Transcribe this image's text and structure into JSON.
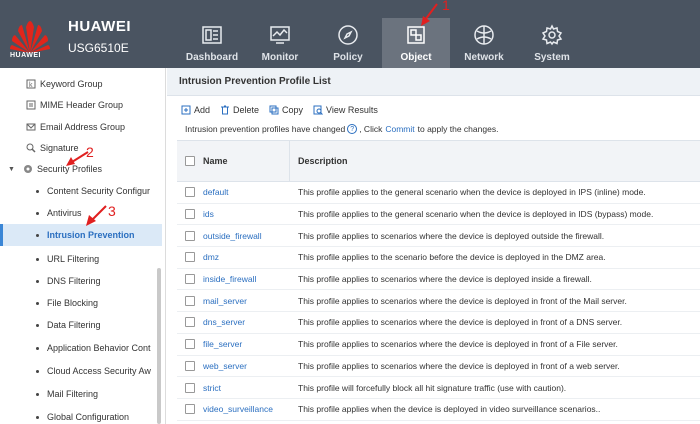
{
  "header": {
    "logo_text": "HUAWEI",
    "brand": "HUAWEI",
    "model": "USG6510E",
    "nav": [
      {
        "label": "Dashboard",
        "icon": "dashboard-icon"
      },
      {
        "label": "Monitor",
        "icon": "monitor-icon"
      },
      {
        "label": "Policy",
        "icon": "compass-icon"
      },
      {
        "label": "Object",
        "icon": "object-icon",
        "active": true
      },
      {
        "label": "Network",
        "icon": "globe-icon"
      },
      {
        "label": "System",
        "icon": "gear-icon"
      }
    ]
  },
  "sidebar": {
    "items": [
      {
        "label": "Keyword Group",
        "icon": "keyword-group-icon"
      },
      {
        "label": "MIME Header Group",
        "icon": "mime-header-icon"
      },
      {
        "label": "Email Address Group",
        "icon": "email-group-icon"
      },
      {
        "label": "Signature",
        "icon": "signature-icon"
      },
      {
        "label": "Security Profiles",
        "icon": "security-profiles-icon"
      },
      {
        "label": "Content Security Configur"
      },
      {
        "label": "Antivirus"
      },
      {
        "label": "Intrusion Prevention",
        "active": true
      },
      {
        "label": "URL Filtering"
      },
      {
        "label": "DNS Filtering"
      },
      {
        "label": "File Blocking"
      },
      {
        "label": "Data Filtering"
      },
      {
        "label": "Application Behavior Cont"
      },
      {
        "label": "Cloud Access Security Aw"
      },
      {
        "label": "Mail Filtering"
      },
      {
        "label": "Global Configuration"
      }
    ]
  },
  "main": {
    "title": "Intrusion Prevention Profile List",
    "toolbar": {
      "add": "Add",
      "delete": "Delete",
      "copy": "Copy",
      "view": "View Results"
    },
    "notice": {
      "before": "Intrusion prevention profiles have changed",
      "mid": ", Click",
      "link": "Commit",
      "after": "to apply the changes."
    },
    "columns": {
      "name": "Name",
      "description": "Description"
    },
    "rows": [
      {
        "name": "default",
        "description": "This profile applies to the general scenario when the device is deployed in IPS (inline) mode."
      },
      {
        "name": "ids",
        "description": "This profile applies to the general scenario when the device is deployed in IDS (bypass) mode."
      },
      {
        "name": "outside_firewall",
        "description": "This profile applies to scenarios where the device is deployed outside the firewall."
      },
      {
        "name": "dmz",
        "description": "This profile applies to the scenario before the device is deployed in the DMZ area."
      },
      {
        "name": "inside_firewall",
        "description": "This profile applies to scenarios where the device is deployed inside a firewall."
      },
      {
        "name": "mail_server",
        "description": "This profile applies to scenarios where the device is deployed in front of the Mail server."
      },
      {
        "name": "dns_server",
        "description": "This profile applies to scenarios where the device is deployed in front of a DNS server."
      },
      {
        "name": "file_server",
        "description": "This profile applies to scenarios where the device is deployed in front of a File server."
      },
      {
        "name": "web_server",
        "description": "This profile applies to scenarios where the device is deployed in front of a web server."
      },
      {
        "name": "strict",
        "description": "This profile will forcefully block all hit signature traffic (use with caution)."
      },
      {
        "name": "video_surveillance",
        "description": "This profile applies when the device is deployed in video surveillance scenarios.."
      }
    ]
  },
  "annotations": [
    "1",
    "2",
    "3"
  ],
  "colors": {
    "header": "#4a5461",
    "active_nav": "#6b737e",
    "link": "#2b6fc0",
    "annotation": "#e02020",
    "sidebar_active": "#dbe9f7"
  }
}
